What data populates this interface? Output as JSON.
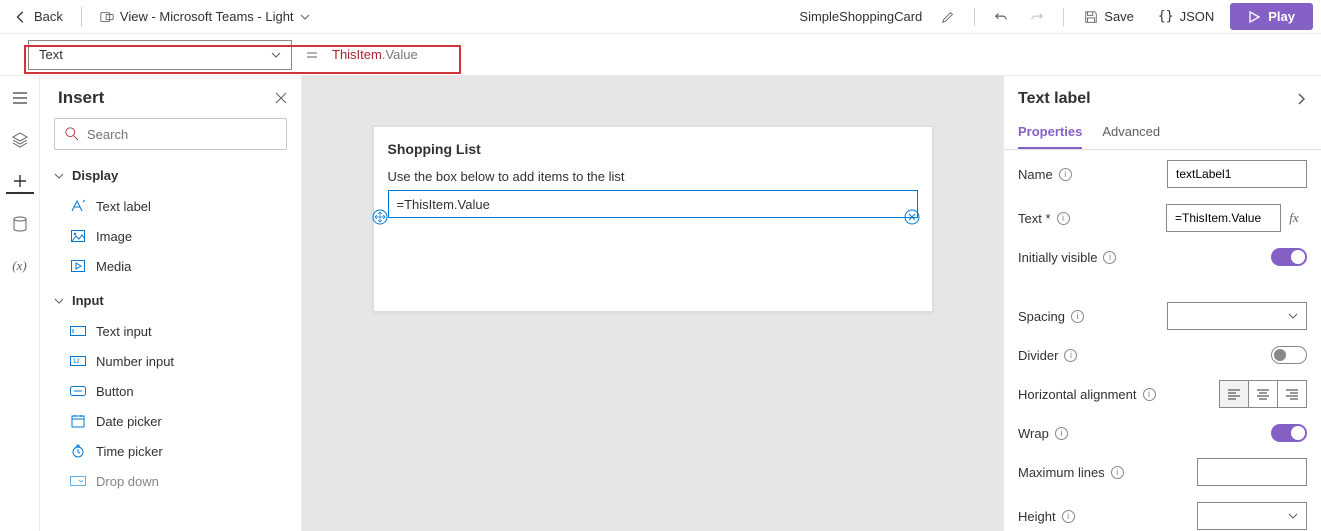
{
  "topbar": {
    "back": "Back",
    "view_label": "View - Microsoft Teams - Light",
    "app_name": "SimpleShoppingCard",
    "save": "Save",
    "json": "JSON",
    "play": "Play"
  },
  "formula": {
    "property": "Text",
    "prefix": "ThisItem",
    "suffix": ".Value"
  },
  "insert": {
    "title": "Insert",
    "search_placeholder": "Search",
    "groups": [
      {
        "name": "Display",
        "items": [
          "Text label",
          "Image",
          "Media"
        ]
      },
      {
        "name": "Input",
        "items": [
          "Text input",
          "Number input",
          "Button",
          "Date picker",
          "Time picker",
          "Drop down"
        ]
      }
    ]
  },
  "canvas": {
    "card_title": "Shopping List",
    "card_sub": "Use the box below to add items to the list",
    "textbox_value": "=ThisItem.Value"
  },
  "props": {
    "title": "Text label",
    "tabs": [
      "Properties",
      "Advanced"
    ],
    "name_label": "Name",
    "name_value": "textLabel1",
    "text_label": "Text *",
    "text_value": "=ThisItem.Value",
    "initially_visible": "Initially visible",
    "spacing": "Spacing",
    "divider": "Divider",
    "h_align": "Horizontal alignment",
    "wrap": "Wrap",
    "max_lines": "Maximum lines",
    "height": "Height"
  }
}
